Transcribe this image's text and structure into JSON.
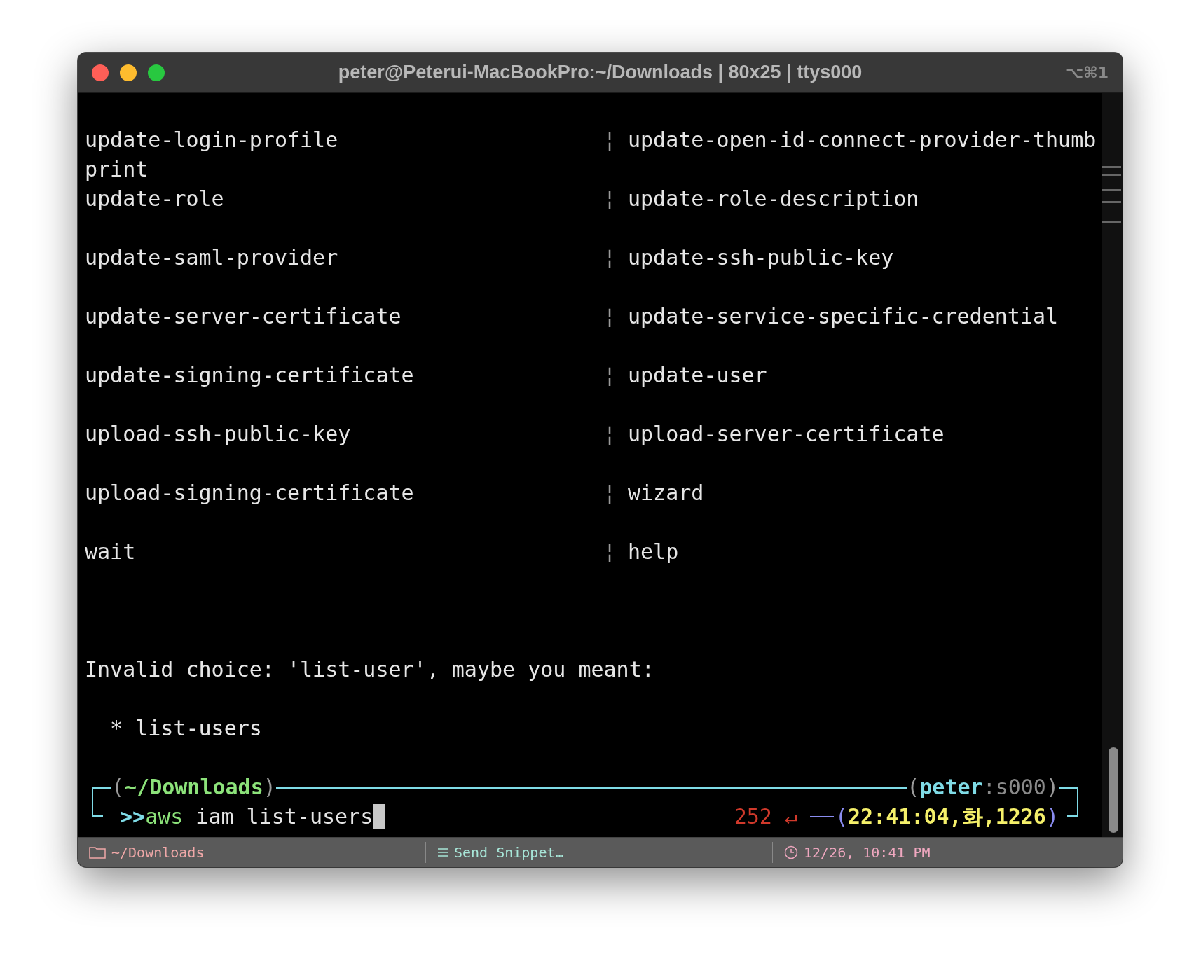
{
  "window": {
    "title": "peter@Peterui-MacBookPro:~/Downloads | 80x25 | ttys000",
    "shortcut": "⌥⌘1"
  },
  "lines": [
    {
      "kind": "pair",
      "left": "update-login-profile",
      "separator": "¦",
      "right": "update-open-id-connect-provider-thumb"
    },
    {
      "kind": "text",
      "text": "print"
    },
    {
      "kind": "pair",
      "left": "update-role",
      "separator": "¦",
      "right": "update-role-description"
    },
    {
      "kind": "blank"
    },
    {
      "kind": "pair",
      "left": "update-saml-provider",
      "separator": "¦",
      "right": "update-ssh-public-key"
    },
    {
      "kind": "blank"
    },
    {
      "kind": "pair",
      "left": "update-server-certificate",
      "separator": "¦",
      "right": "update-service-specific-credential"
    },
    {
      "kind": "blank"
    },
    {
      "kind": "pair",
      "left": "update-signing-certificate",
      "separator": "¦",
      "right": "update-user"
    },
    {
      "kind": "blank"
    },
    {
      "kind": "pair",
      "left": "upload-ssh-public-key",
      "separator": "¦",
      "right": "upload-server-certificate"
    },
    {
      "kind": "blank"
    },
    {
      "kind": "pair",
      "left": "upload-signing-certificate",
      "separator": "¦",
      "right": "wizard"
    },
    {
      "kind": "blank"
    },
    {
      "kind": "pair",
      "left": "wait",
      "separator": "¦",
      "right": "help"
    },
    {
      "kind": "blank"
    },
    {
      "kind": "blank"
    },
    {
      "kind": "blank"
    },
    {
      "kind": "text",
      "text": "Invalid choice: 'list-user', maybe you meant:"
    },
    {
      "kind": "blank"
    },
    {
      "kind": "text",
      "text": "  * list-users"
    },
    {
      "kind": "blank"
    }
  ],
  "prompt": {
    "open": "(",
    "cwd": "~/Downloads",
    "close": ")",
    "user": "peter",
    "colon": ":",
    "session": "s000",
    "marker": ">>",
    "command": "aws",
    "args": " iam list-users",
    "exit_code": "252",
    "return_symbol": "↵",
    "clock": "22:41:04,화,1226"
  },
  "status_bar": [
    {
      "kind": "folder",
      "text": "~/Downloads"
    },
    {
      "kind": "snippet",
      "text": "Send Snippet…"
    },
    {
      "kind": "clock",
      "text": "12/26, 10:41 PM"
    }
  ]
}
